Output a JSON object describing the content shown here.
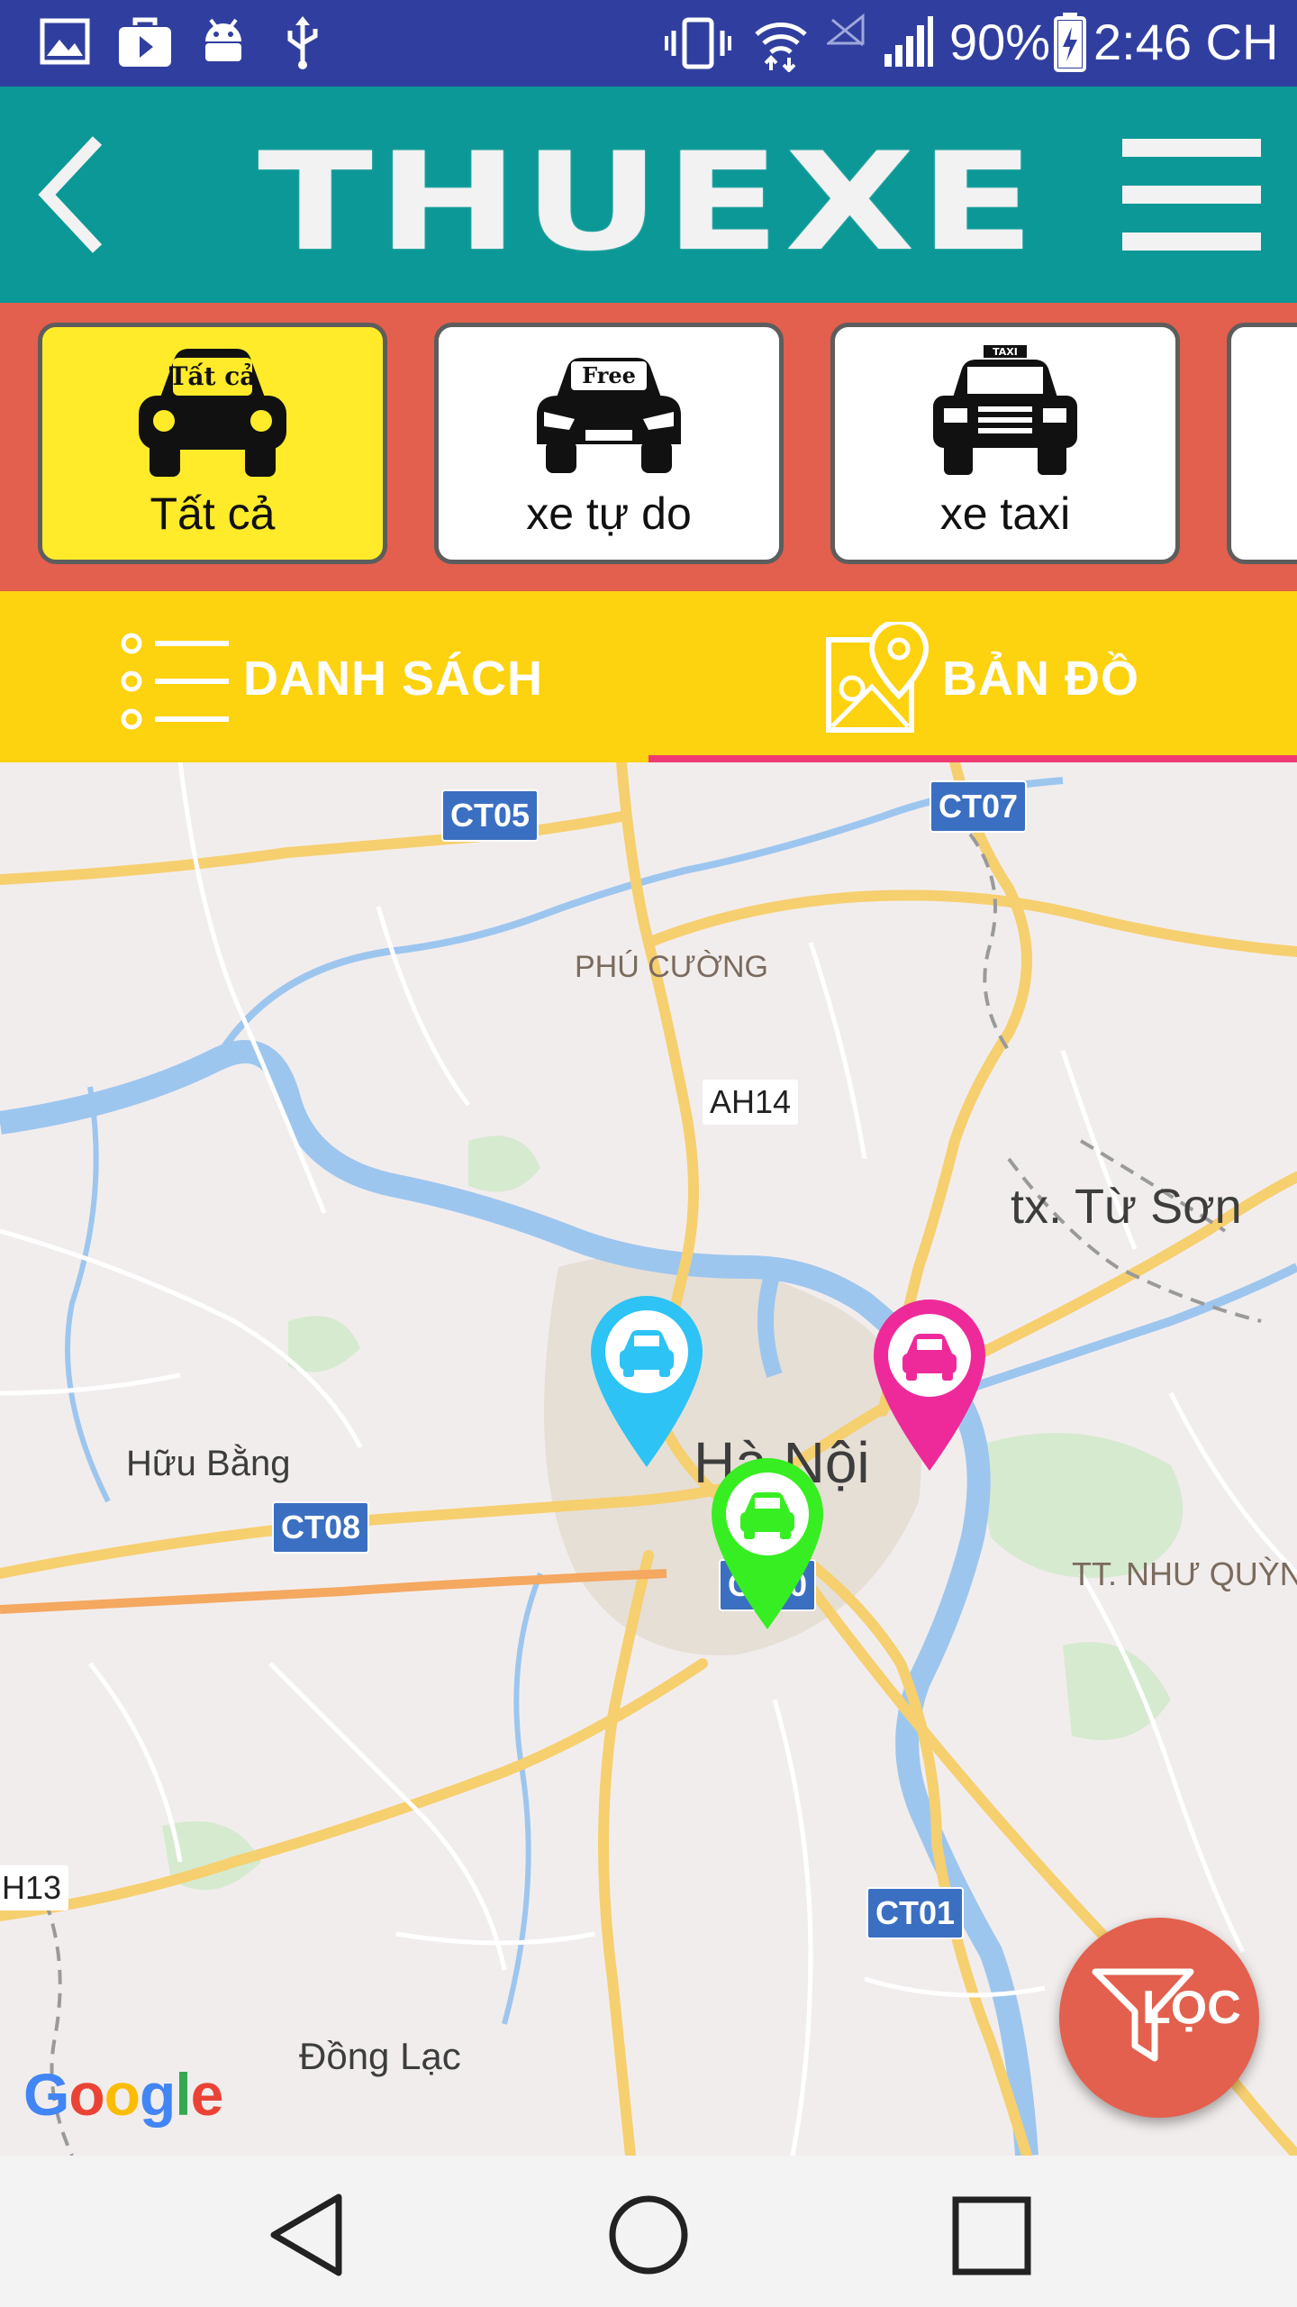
{
  "status_bar": {
    "battery_percent": "90%",
    "time": "2:46 CH",
    "icons": [
      "image-icon",
      "play-store-icon",
      "android-icon",
      "usb-icon",
      "vibrate-icon",
      "wifi-icon",
      "no-signal-icon",
      "signal-icon",
      "battery-charging-icon"
    ]
  },
  "app_bar": {
    "title": "THUEXE",
    "back_icon": "chevron-left-icon",
    "menu_icon": "hamburger-menu-icon"
  },
  "categories": [
    {
      "label": "Tất cả",
      "badge": "Tất cả",
      "icon": "car-all-icon",
      "active": true
    },
    {
      "label": "xe tự do",
      "badge": "Free",
      "icon": "car-free-icon",
      "active": false
    },
    {
      "label": "xe taxi",
      "badge": "TAXI",
      "icon": "taxi-icon",
      "active": false
    }
  ],
  "tabs": {
    "list_label": "DANH SÁCH",
    "map_label": "BẢN ĐỒ",
    "selected": "map"
  },
  "map": {
    "highways": [
      "CT05",
      "CT07",
      "CT08",
      "CT20",
      "CT01"
    ],
    "roads": [
      "AH14",
      "H13"
    ],
    "places": {
      "phu_cuong": "PHÚ CƯỜNG",
      "tu_son": "tx. Từ Sơn",
      "huu_bang": "Hữu Bằng",
      "ha_noi": "Hà Nội",
      "nhu_quynh": "TT. NHƯ QUỲNH",
      "dong_lac": "Đồng Lạc"
    },
    "pins": [
      {
        "color": "#2dc3f5",
        "icon": "car-icon"
      },
      {
        "color": "#ee2a9a",
        "icon": "car-icon"
      },
      {
        "color": "#37ee22",
        "icon": "car-icon"
      }
    ],
    "attribution": "Google"
  },
  "filter_button": {
    "label": "LỌC",
    "icon": "filter-funnel-icon"
  },
  "nav_bar": {
    "icons": [
      "back-triangle-icon",
      "home-circle-icon",
      "recents-square-icon"
    ]
  }
}
